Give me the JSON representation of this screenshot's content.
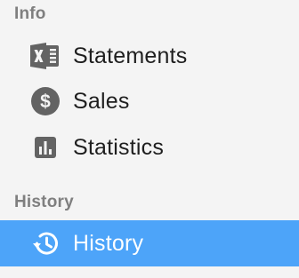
{
  "sections": [
    {
      "header": "Info",
      "items": [
        {
          "label": "Statements",
          "icon": "excel-icon"
        },
        {
          "label": "Sales",
          "icon": "dollar-circle-icon"
        },
        {
          "label": "Statistics",
          "icon": "bar-chart-icon"
        }
      ]
    },
    {
      "header": "History",
      "items": [
        {
          "label": "History",
          "icon": "history-icon",
          "selected": true
        }
      ]
    }
  ],
  "colors": {
    "background": "#f4f4f4",
    "header_text": "#7f7f7f",
    "item_text": "#1e1e1e",
    "icon": "#636363",
    "selected_background": "#4da4f9",
    "selected_text": "#ffffff"
  }
}
